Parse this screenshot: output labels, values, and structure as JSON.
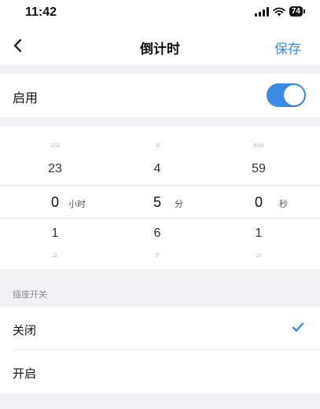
{
  "status_bar": {
    "time": "11:42",
    "battery": "74"
  },
  "nav": {
    "title": "倒计时",
    "save_label": "保存",
    "back_icon": "chevron-left-icon"
  },
  "enable": {
    "label": "启用",
    "on": true
  },
  "picker": {
    "hours": {
      "values": [
        "22",
        "23",
        "0",
        "1",
        "2"
      ],
      "unit": "小时"
    },
    "minutes": {
      "values": [
        "3",
        "4",
        "5",
        "6",
        "7"
      ],
      "unit": "分"
    },
    "seconds": {
      "values": [
        "58",
        "59",
        "0",
        "1",
        "2"
      ],
      "unit": "秒"
    }
  },
  "socket_section": {
    "header": "插座开关",
    "options": [
      {
        "label": "关闭",
        "selected": true
      },
      {
        "label": "开启",
        "selected": false
      }
    ]
  },
  "colors": {
    "accent": "#3b8ae6",
    "background": "#f2f2f4"
  }
}
